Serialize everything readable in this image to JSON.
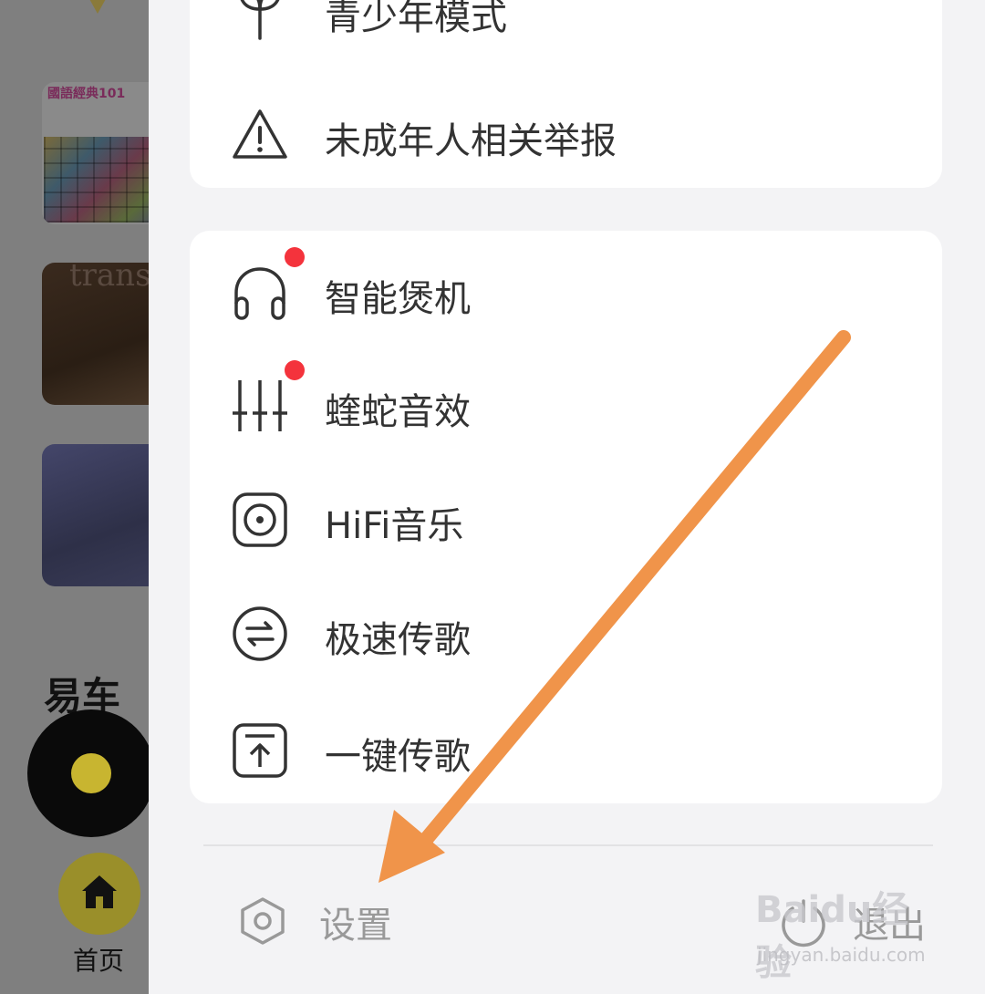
{
  "background_app": {
    "album1_title": "國語經典101",
    "album2_title": "transi",
    "section_heading": "易车",
    "tab_home": "首页"
  },
  "drawer": {
    "card1": [
      {
        "label": "青少年模式",
        "icon": "sprout-icon"
      },
      {
        "label": "未成年人相关举报",
        "icon": "warning-icon"
      }
    ],
    "card2": [
      {
        "label": "智能煲机",
        "icon": "headphones-icon",
        "red_dot": true
      },
      {
        "label": "蝰蛇音效",
        "icon": "equalizer-icon",
        "red_dot": true
      },
      {
        "label": "HiFi音乐",
        "icon": "speaker-icon",
        "red_dot": false
      },
      {
        "label": "极速传歌",
        "icon": "transfer-icon",
        "red_dot": false
      },
      {
        "label": "一键传歌",
        "icon": "upload-icon",
        "red_dot": false
      }
    ],
    "footer": {
      "settings_label": "设置",
      "logout_label": "退出"
    }
  },
  "watermark": {
    "brand": "Baidu经验",
    "url": "jingyan.baidu.com"
  },
  "colors": {
    "accent_dot": "#f4333c",
    "arrow": "#f0944a",
    "overlay": "#7f7f7f"
  }
}
